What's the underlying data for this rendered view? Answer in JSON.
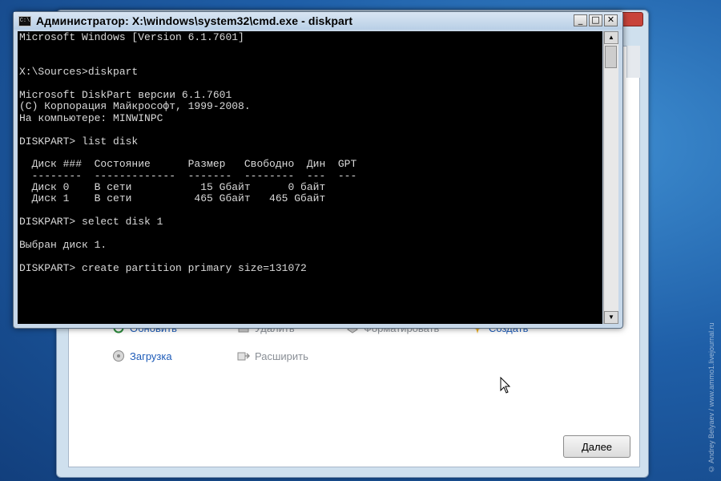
{
  "cmd_window": {
    "title": "Администратор: X:\\windows\\system32\\cmd.exe - diskpart",
    "icon_text": "C:\\",
    "buttons": {
      "minimize": "_",
      "maximize": "□",
      "close": "✕"
    },
    "console_lines": [
      "Microsoft Windows [Version 6.1.7601]",
      "",
      "",
      "X:\\Sources>diskpart",
      "",
      "Microsoft DiskPart версии 6.1.7601",
      "(C) Корпорация Майкрософт, 1999-2008.",
      "На компьютере: MINWINPC",
      "",
      "DISKPART> list disk",
      "",
      "  Диск ###  Состояние      Размер   Свободно  Дин  GPT",
      "  --------  -------------  -------  --------  ---  ---",
      "  Диск 0    В сети           15 Gбайт      0 байт",
      "  Диск 1    В сети          465 Gбайт   465 Gбайт",
      "",
      "DISKPART> select disk 1",
      "",
      "Выбран диск 1.",
      "",
      "DISKPART> create partition primary size=131072"
    ]
  },
  "setup_window": {
    "actions": [
      {
        "label": "Обновить",
        "icon": "refresh-icon"
      },
      {
        "label": "Удалить",
        "icon": "delete-icon"
      },
      {
        "label": "Форматировать",
        "icon": "format-icon"
      },
      {
        "label": "Создать",
        "icon": "new-icon"
      },
      {
        "label": "Загрузка",
        "icon": "load-driver-icon"
      },
      {
        "label": "Расширить",
        "icon": "extend-icon"
      }
    ],
    "next_button": "Далее",
    "watermark": "© Andrey Belyaev / www.ammo1.livejournal.ru"
  },
  "colors": {
    "desktop": "#1f5fa8",
    "console_bg": "#000000",
    "console_text": "#d9d9d9",
    "link": "#1d5bb8"
  }
}
